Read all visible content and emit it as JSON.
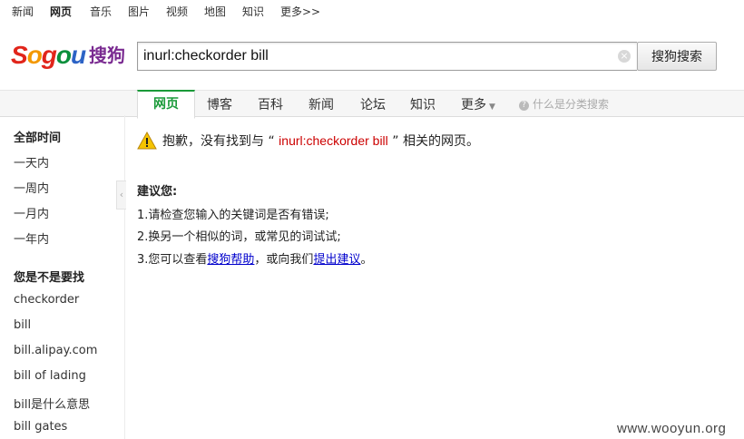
{
  "top_nav": [
    "新闻",
    "网页",
    "音乐",
    "图片",
    "视频",
    "地图",
    "知识",
    "更多>>"
  ],
  "logo": {
    "brand": "Sogou",
    "tail": "搜狗"
  },
  "search": {
    "query": "inurl:checkorder bill",
    "button_label": "搜狗搜索",
    "clear_glyph": "×"
  },
  "tabs": [
    "网页",
    "博客",
    "百科",
    "新闻",
    "论坛",
    "知识",
    "更多"
  ],
  "help_link": "什么是分类搜索",
  "sidebar": {
    "time_header": "全部时间",
    "time_items": [
      "一天内",
      "一周内",
      "一月内",
      "一年内"
    ],
    "related_header": "您是不是要找",
    "related_items": [
      "checkorder",
      "bill",
      "bill.alipay.com",
      "bill of lading",
      "bill是什么意思",
      "bill gates"
    ]
  },
  "result": {
    "sorry_prefix": "抱歉，没有找到与",
    "open_quote": "“",
    "query": "inurl:checkorder bill",
    "close_quote": "”",
    "sorry_suffix": "相关的网页。",
    "suggest_title": "建议您:",
    "s1": "1.请检查您输入的关键词是否有错误;",
    "s2": "2.换另一个相似的词，或常见的词试试;",
    "s3_prefix": "3.您可以查看",
    "s3_link1": "搜狗帮助",
    "s3_mid": "，或向我们",
    "s3_link2": "提出建议",
    "s3_suffix": "。"
  },
  "watermark": "www.wooyun.org",
  "colors": {
    "accent_green": "#1a9a39",
    "query_red": "#cc0000",
    "link_blue": "#0000cc",
    "warning_yellow": "#f5c400"
  }
}
